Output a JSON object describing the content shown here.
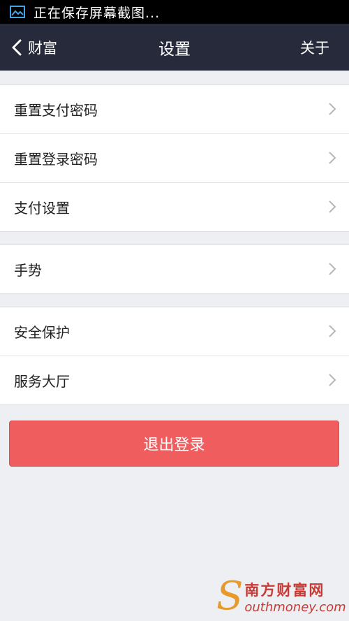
{
  "status_bar": {
    "text": "正在保存屏幕截图...",
    "icon": "screenshot-icon"
  },
  "nav": {
    "back_label": "财富",
    "title": "设置",
    "about_label": "关于"
  },
  "groups": [
    {
      "items": [
        {
          "label": "重置支付密码"
        },
        {
          "label": "重置登录密码"
        },
        {
          "label": "支付设置"
        }
      ]
    },
    {
      "items": [
        {
          "label": "手势"
        }
      ]
    },
    {
      "items": [
        {
          "label": "安全保护"
        },
        {
          "label": "服务大厅"
        }
      ]
    }
  ],
  "logout_label": "退出登录",
  "watermark": {
    "initial": "S",
    "cn": "南方财富网",
    "en": "outhmoney.com"
  },
  "colors": {
    "status_bar": "#000000",
    "nav_bar": "#262a3a",
    "page_background": "#eeeff3",
    "logout_button": "#ef5d5f"
  }
}
